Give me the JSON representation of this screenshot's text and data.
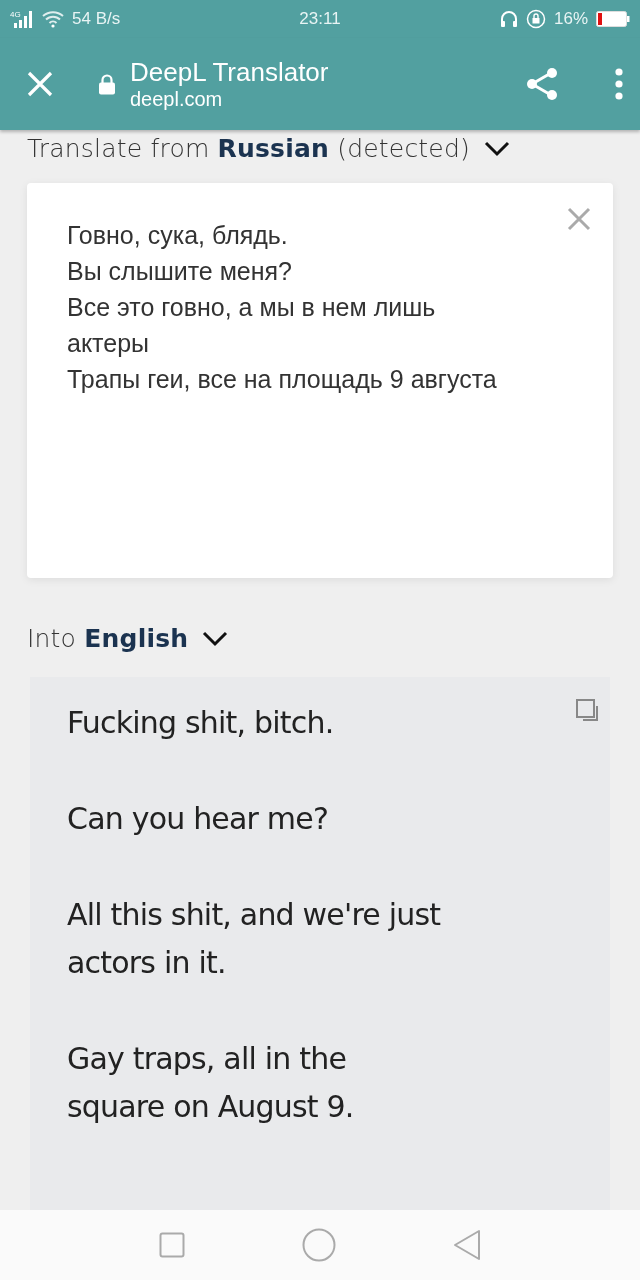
{
  "status_bar": {
    "network": "4G",
    "speed": "54 B/s",
    "time": "23:11",
    "battery": "16%"
  },
  "toolbar": {
    "title": "DeepL Translator",
    "url": "deepl.com"
  },
  "source": {
    "label": "Translate from **Russian** (detected)",
    "lines": [
      "Говно, сука, блядь.",
      "Вы слышите меня?",
      "Все это говно, а мы в нем лишь",
      "актеры",
      "Трапы геи, все на площадь 9 августа"
    ]
  },
  "target": {
    "label": "Into **English**",
    "paragraphs": [
      [
        "Fucking shit, bitch."
      ],
      [
        "Can you hear me?"
      ],
      [
        "All this shit, and we're just",
        "actors in it."
      ],
      [
        "Gay traps, all in the",
        "square on August 9."
      ]
    ]
  }
}
